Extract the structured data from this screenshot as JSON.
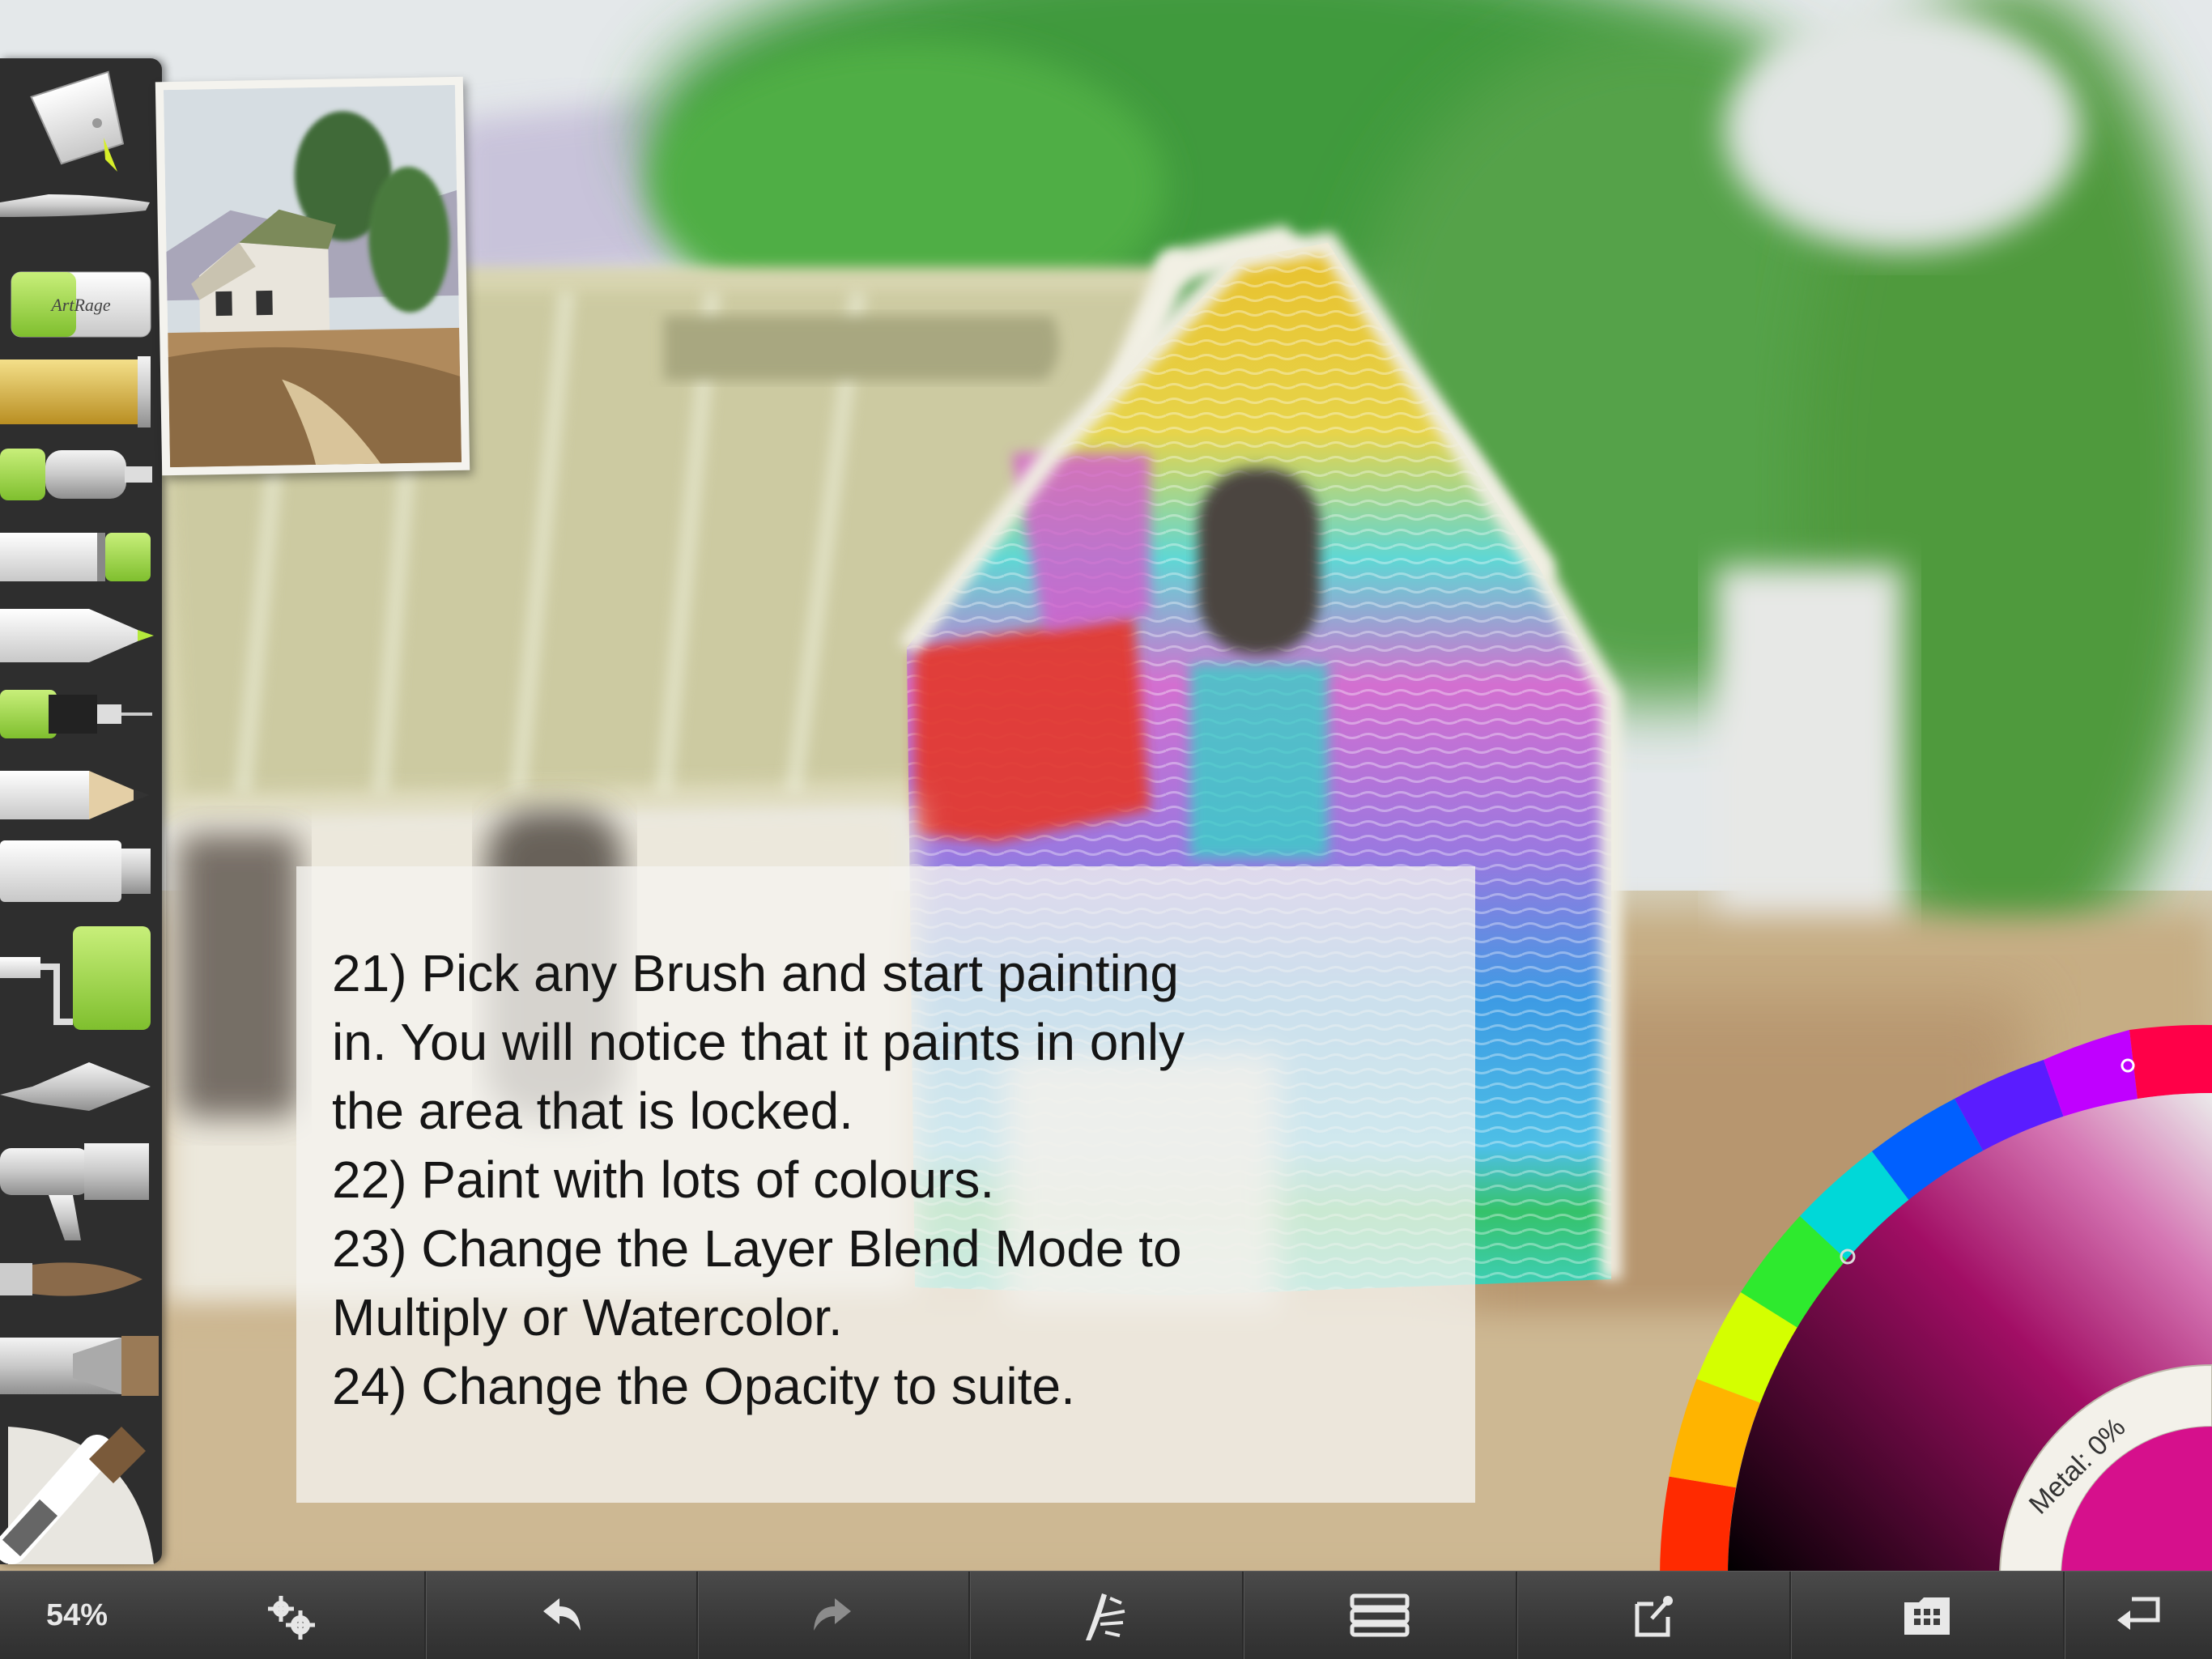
{
  "app": {
    "zoom_label": "54%"
  },
  "toolbar": {
    "tools": [
      {
        "name": "paint-bucket"
      },
      {
        "name": "palette-knife-thin"
      },
      {
        "name": "eraser",
        "logo_text": "ArtRage"
      },
      {
        "name": "glitter-tube"
      },
      {
        "name": "airbrush-small"
      },
      {
        "name": "felt-pen"
      },
      {
        "name": "marker"
      },
      {
        "name": "technical-pen"
      },
      {
        "name": "pencil"
      },
      {
        "name": "paint-tube"
      },
      {
        "name": "paint-roller"
      },
      {
        "name": "palette-knife"
      },
      {
        "name": "airbrush"
      },
      {
        "name": "watercolor-brush"
      },
      {
        "name": "flat-brush"
      },
      {
        "name": "oil-brush-active"
      }
    ]
  },
  "instructions": {
    "lines": [
      "21) Pick any Brush and start painting",
      "in. You will notice that it paints in only",
      "the area that is locked.",
      "22) Paint with lots of colours.",
      "23) Change the Layer Blend Mode to",
      "Multiply or Watercolor.",
      "24) Change the Opacity to suite."
    ]
  },
  "color_picker": {
    "metal_label": "Metal: 0%",
    "current_color": "#d6108c",
    "accent_colors": {
      "hue_ring_top": "#ff0000",
      "swatch": "#d6108c"
    }
  },
  "bottom_bar": {
    "items": [
      {
        "name": "zoom"
      },
      {
        "name": "settings-gears-icon"
      },
      {
        "name": "undo-icon"
      },
      {
        "name": "redo-icon"
      },
      {
        "name": "brush-settings-icon"
      },
      {
        "name": "layers-icon"
      },
      {
        "name": "share-icon"
      },
      {
        "name": "gallery-icon"
      },
      {
        "name": "return-icon"
      }
    ]
  }
}
